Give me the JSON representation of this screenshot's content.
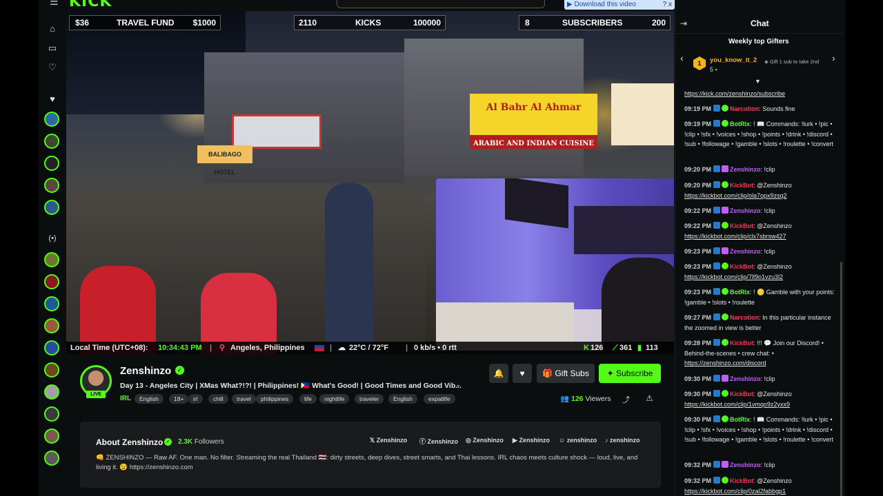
{
  "topbar": {
    "logo": "KICK",
    "download_bar": "▶ Download this video",
    "download_help": "?",
    "download_close": "x"
  },
  "goals": [
    {
      "left": "$36",
      "label": "TRAVEL FUND",
      "right": "$1000"
    },
    {
      "left": "2110",
      "label": "KICKS",
      "right": "100000"
    },
    {
      "left": "8",
      "label": "SUBSCRIBERS",
      "right": "200"
    }
  ],
  "status": {
    "time_label": "Local Time (UTC+08):",
    "time_value": "10:34:43 PM",
    "location": "Angeles, Philippines",
    "weather": "22°C / 72°F",
    "network": "0 kb/s • 0 rtt",
    "stat1": "126",
    "stat2": "361",
    "stat3": "113"
  },
  "signs": {
    "hotel": "BALIBAGO HOTEL",
    "arabic": "Al Bahr Al Ahmar",
    "cuisine": "ARABIC AND INDIAN CUISINE"
  },
  "channel": {
    "name": "Zenshinzo",
    "live": "LIVE",
    "title": "Day 13 - Angeles City | XMas What?!?! | Philippines! 🇵🇭 What's Good! | Good Times and Good Vib...",
    "category": "IRL",
    "tags": [
      "English",
      "18+",
      "irl",
      "chill",
      "travel",
      "philippines",
      "life",
      "nightlife",
      "traveler",
      "English",
      "expatlife"
    ],
    "gift_subs": "Gift Subs",
    "subscribe": "Subscribe",
    "viewers_count": "126",
    "viewers_label": "Viewers"
  },
  "about": {
    "title": "About Zenshinzo",
    "followers_count": "2.3K",
    "followers_label": "Followers",
    "socials": [
      "Zenshinzo",
      "Zenshinzo",
      "Zenshinzo",
      "Zenshinzo",
      "zenshinzo",
      "zenshinzo"
    ],
    "description": "👊 ZENSHINZO — Raw AF. One man. No filter. Streaming the real Thailand 🇹🇭: dirty streets, deep dives, street smarts, and Thai lessons. IRL chaos meets culture shock — loud, live, and living it. 😉 https://zenshinzo.com"
  },
  "chat": {
    "title": "Chat",
    "weekly_title": "Weekly top Gifters",
    "gifter_rank": "1",
    "gifter_name": "you_know_it_2",
    "gifter_count": "5",
    "gift_cta": "Gift 1 sub to take 2nd",
    "messages": [
      {
        "time": "",
        "user": "",
        "text": "",
        "link": "https://kick.com/zenshinzo/subscribe"
      },
      {
        "time": "09:19 PM",
        "user": "Narcotion",
        "text": "Sounds fine",
        "link": ""
      },
      {
        "time": "09:19 PM",
        "user": "BotRix",
        "text": "! 📖 Commands: !lurk • !pic • !clip • !sfx • !voices • !shop • !points • !drink • !discord • !sub • !followage • !gamble • !slots • !roulette • !convert",
        "link": ""
      },
      {
        "time": "09:20 PM",
        "user": "Zenshinzo",
        "text": "!clip",
        "link": ""
      },
      {
        "time": "09:20 PM",
        "user": "KickBot",
        "text": "@Zenshinzo",
        "link": "https://kickbot.com/clip/ola7opx9zsq2"
      },
      {
        "time": "09:22 PM",
        "user": "Zenshinzo",
        "text": "!clip",
        "link": ""
      },
      {
        "time": "09:22 PM",
        "user": "KickBot",
        "text": "@Zenshinzo",
        "link": "https://kickbot.com/clip/clx7sbrsw427"
      },
      {
        "time": "09:23 PM",
        "user": "Zenshinzo",
        "text": "!clip",
        "link": ""
      },
      {
        "time": "09:23 PM",
        "user": "KickBot",
        "text": "@Zenshinzo",
        "link": "https://kickbot.com/clip/7ll9o1vzu3l2"
      },
      {
        "time": "09:23 PM",
        "user": "BotRix",
        "text": "! 🪙 Gamble with your points: !gamble • !slots • !roulette",
        "link": ""
      },
      {
        "time": "09:27 PM",
        "user": "Narcotion",
        "text": "In this particular instance the zoomed in view is better",
        "link": ""
      },
      {
        "time": "09:28 PM",
        "user": "KickBot",
        "text": "!!! 💬 Join our Discord! • Behind-the-scenes • crew chat: •",
        "link": "https://zenshinzo.com/discord"
      },
      {
        "time": "09:30 PM",
        "user": "Zenshinzo",
        "text": "!clip",
        "link": ""
      },
      {
        "time": "09:30 PM",
        "user": "KickBot",
        "text": "@Zenshinzo",
        "link": "https://kickbot.com/clip/1vmqo9z2yxx9"
      },
      {
        "time": "09:30 PM",
        "user": "BotRix",
        "text": "! 📖 Commands: !lurk • !pic • !clip • !sfx • !voices • !shop • !points • !drink • !discord • !sub • !followage • !gamble • !slots • !roulette • !convert",
        "link": ""
      },
      {
        "time": "09:32 PM",
        "user": "Zenshinzo",
        "text": "!clip",
        "link": ""
      },
      {
        "time": "09:32 PM",
        "user": "KickBot",
        "text": "@Zenshinzo",
        "link": "https://kickbot.com/clip/0zal2fabbgp1"
      }
    ]
  },
  "colors": {
    "accent": "#53fc18",
    "narcotion": "#ff3b5c",
    "botrix": "#5bff3a",
    "zenshinzo": "#c45bff",
    "kickbot": "#ff2d55"
  }
}
